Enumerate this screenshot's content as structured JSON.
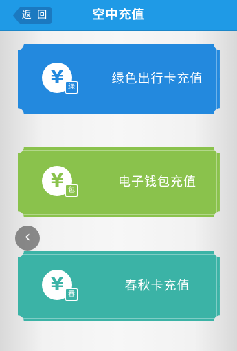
{
  "header": {
    "back_label": "返 回",
    "title": "空中充值"
  },
  "cards": [
    {
      "icon_symbol": "¥",
      "icon_name": "yuan-coin-icon",
      "badge": "绿",
      "label": "绿色出行卡充值",
      "color": "#2389de"
    },
    {
      "icon_symbol": "¥",
      "icon_name": "yuan-coin-icon",
      "badge": "包",
      "label": "电子钱包充值",
      "color": "#8ac24c"
    },
    {
      "icon_symbol": "¥",
      "icon_name": "yuan-coin-icon",
      "badge": "春",
      "label": "春秋卡充值",
      "color": "#3bb3a6"
    }
  ],
  "floating_back": {
    "icon_name": "chevron-left-icon",
    "symbol": "‹"
  },
  "colors": {
    "header_bg": "#1f9ae6",
    "back_button_bg": "#1b79c0"
  }
}
